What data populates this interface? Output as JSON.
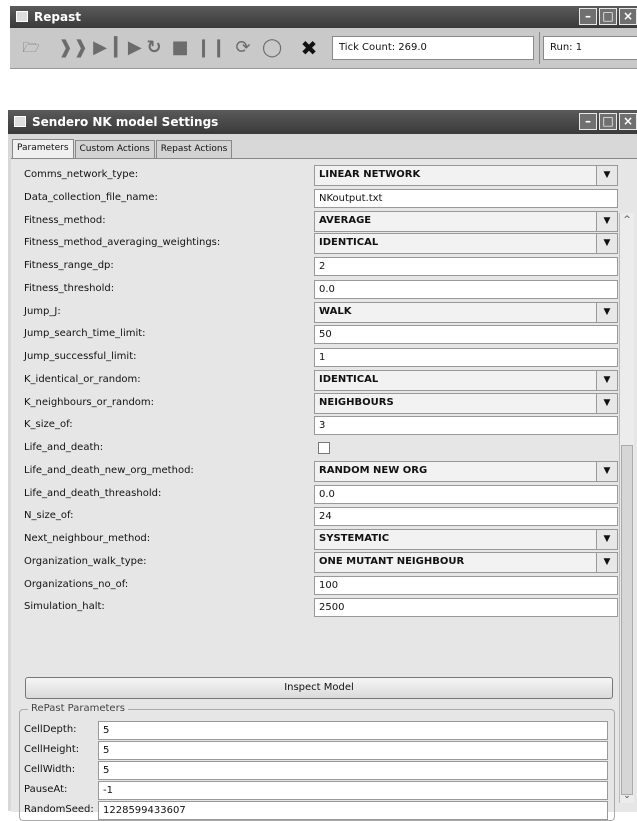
{
  "repast_window": {
    "title": "Repast",
    "tick_count": "Tick Count: 269.0",
    "run": "Run: 1",
    "icons": [
      "open-folder-icon",
      "step-forward-icon",
      "play-icon",
      "step-icon",
      "reset-icon",
      "stop-icon",
      "pause-icon",
      "setup-icon",
      "info-bulb-icon",
      "exit-icon"
    ]
  },
  "settings_window": {
    "title": "Sendero NK model Settings",
    "tabs": [
      "Parameters",
      "Custom Actions",
      "Repast Actions"
    ],
    "parameters": [
      {
        "label": "Comms_network_type:",
        "value": "LINEAR NETWORK",
        "type": "combo"
      },
      {
        "label": "Data_collection_file_name:",
        "value": "NKoutput.txt",
        "type": "text"
      },
      {
        "label": "Fitness_method:",
        "value": "AVERAGE",
        "type": "combo"
      },
      {
        "label": "Fitness_method_averaging_weightings:",
        "value": "IDENTICAL",
        "type": "combo"
      },
      {
        "label": "Fitness_range_dp:",
        "value": "2",
        "type": "text"
      },
      {
        "label": "Fitness_threshold:",
        "value": "0.0",
        "type": "text"
      },
      {
        "label": "Jump_J:",
        "value": "WALK",
        "type": "combo"
      },
      {
        "label": "Jump_search_time_limit:",
        "value": "50",
        "type": "text"
      },
      {
        "label": "Jump_successful_limit:",
        "value": "1",
        "type": "text"
      },
      {
        "label": "K_identical_or_random:",
        "value": "IDENTICAL",
        "type": "combo"
      },
      {
        "label": "K_neighbours_or_random:",
        "value": "NEIGHBOURS",
        "type": "combo"
      },
      {
        "label": "K_size_of:",
        "value": "3",
        "type": "text"
      },
      {
        "label": "Life_and_death:",
        "value": "",
        "type": "checkbox"
      },
      {
        "label": "Life_and_death_new_org_method:",
        "value": "RANDOM NEW ORG",
        "type": "combo"
      },
      {
        "label": "Life_and_death_threashold:",
        "value": "0.0",
        "type": "text"
      },
      {
        "label": "N_size_of:",
        "value": "24",
        "type": "text"
      },
      {
        "label": "Next_neighbour_method:",
        "value": "SYSTEMATIC",
        "type": "combo"
      },
      {
        "label": "Organization_walk_type:",
        "value": "ONE MUTANT NEIGHBOUR",
        "type": "combo"
      },
      {
        "label": "Organizations_no_of:",
        "value": "100",
        "type": "text"
      },
      {
        "label": "Simulation_halt:",
        "value": "2500",
        "type": "text"
      }
    ],
    "inspect_button": "Inspect Model",
    "repast_group_title": "RePast Parameters",
    "repast_params": [
      {
        "label": "CellDepth:",
        "value": "5"
      },
      {
        "label": "CellHeight:",
        "value": "5"
      },
      {
        "label": "CellWidth:",
        "value": "5"
      },
      {
        "label": "PauseAt:",
        "value": "-1"
      },
      {
        "label": "RandomSeed:",
        "value": "1228599433607"
      }
    ]
  }
}
